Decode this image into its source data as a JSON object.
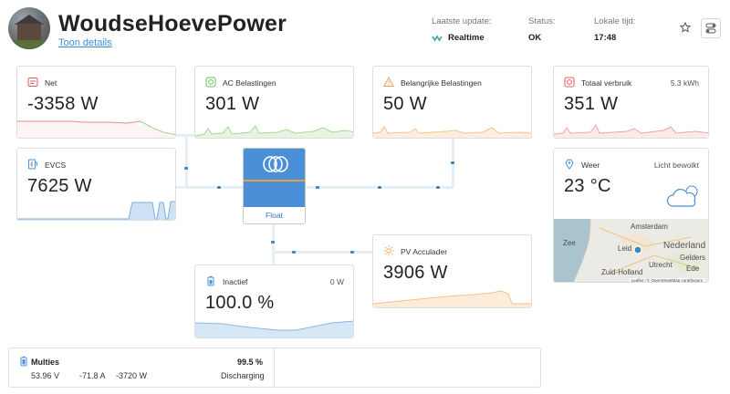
{
  "header": {
    "site_name": "WoudseHoevePower",
    "details_link": "Toon details",
    "last_update_label": "Laatste update:",
    "last_update_value": "Realtime",
    "status_label": "Status:",
    "status_value": "OK",
    "local_time_label": "Lokale tijd:",
    "local_time_value": "17:48"
  },
  "cards": {
    "net": {
      "title": "Net",
      "value": "-3358 W"
    },
    "ac_loads": {
      "title": "AC Belastingen",
      "value": "301 W"
    },
    "critical_loads": {
      "title": "Belangrijke Belastingen",
      "value": "50 W"
    },
    "total": {
      "title": "Totaal verbruik",
      "aux": "5.3 kWh",
      "value": "351 W"
    },
    "evcs": {
      "title": "EVCS",
      "value": "7625 W"
    },
    "inverter": {
      "state": "Float"
    },
    "pv": {
      "title": "PV Acculader",
      "value": "3906 W"
    },
    "battery": {
      "title": "Inactief",
      "aux": "0 W",
      "value": "100.0 %",
      "soc_fraction": 1.0
    },
    "weather": {
      "title": "Weer",
      "aux": "Licht bewolkt",
      "value": "23 °C",
      "map_labels": [
        "Amsterdam",
        "Leid",
        "Nederland",
        "Utrecht",
        "Gelders",
        "Ede",
        "Zuid-Holland",
        "Zee"
      ],
      "map_attribution": "Leaflet | © OpenStreetMap contributors"
    }
  },
  "multies": {
    "title": "Multies",
    "soc": "99.5 %",
    "voltage": "53.96 V",
    "current": "-71.8 A",
    "power": "-3720 W",
    "state": "Discharging"
  },
  "colors": {
    "accent_blue": "#4a8fd8",
    "grid_red": "#e05a5a",
    "green": "#6bbf5a",
    "orange": "#f0a35a",
    "evcs_blue": "#7aaee0"
  }
}
